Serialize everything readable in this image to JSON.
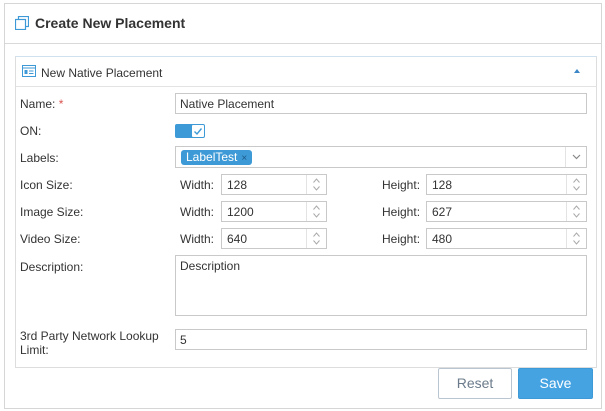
{
  "header": {
    "title": "Create New Placement",
    "icon": "copy-icon"
  },
  "section": {
    "title": "New Native Placement",
    "icon": "form-icon",
    "collapse_icon": "caret-up-icon"
  },
  "form": {
    "name": {
      "label": "Name:",
      "required_mark": "*",
      "value": "Native Placement"
    },
    "on": {
      "label": "ON:",
      "checked": true
    },
    "labels": {
      "label": "Labels:",
      "tags": [
        "LabelTest"
      ],
      "remove_glyph": "×"
    },
    "icon_size": {
      "label": "Icon Size:",
      "width_label": "Width:",
      "width": "128",
      "height_label": "Height:",
      "height": "128"
    },
    "image_size": {
      "label": "Image Size:",
      "width_label": "Width:",
      "width": "1200",
      "height_label": "Height:",
      "height": "627"
    },
    "video_size": {
      "label": "Video Size:",
      "width_label": "Width:",
      "width": "640",
      "height_label": "Height:",
      "height": "480"
    },
    "description": {
      "label": "Description:",
      "value": "Description"
    },
    "lookup_limit": {
      "label_line1": "3rd Party Network Lookup",
      "label_line2": "Limit:",
      "value": "5"
    }
  },
  "actions": {
    "reset_label": "Reset",
    "save_label": "Save"
  },
  "colors": {
    "accent": "#3e9ad6",
    "required": "#d9534f",
    "border": "#c9c9c9"
  }
}
